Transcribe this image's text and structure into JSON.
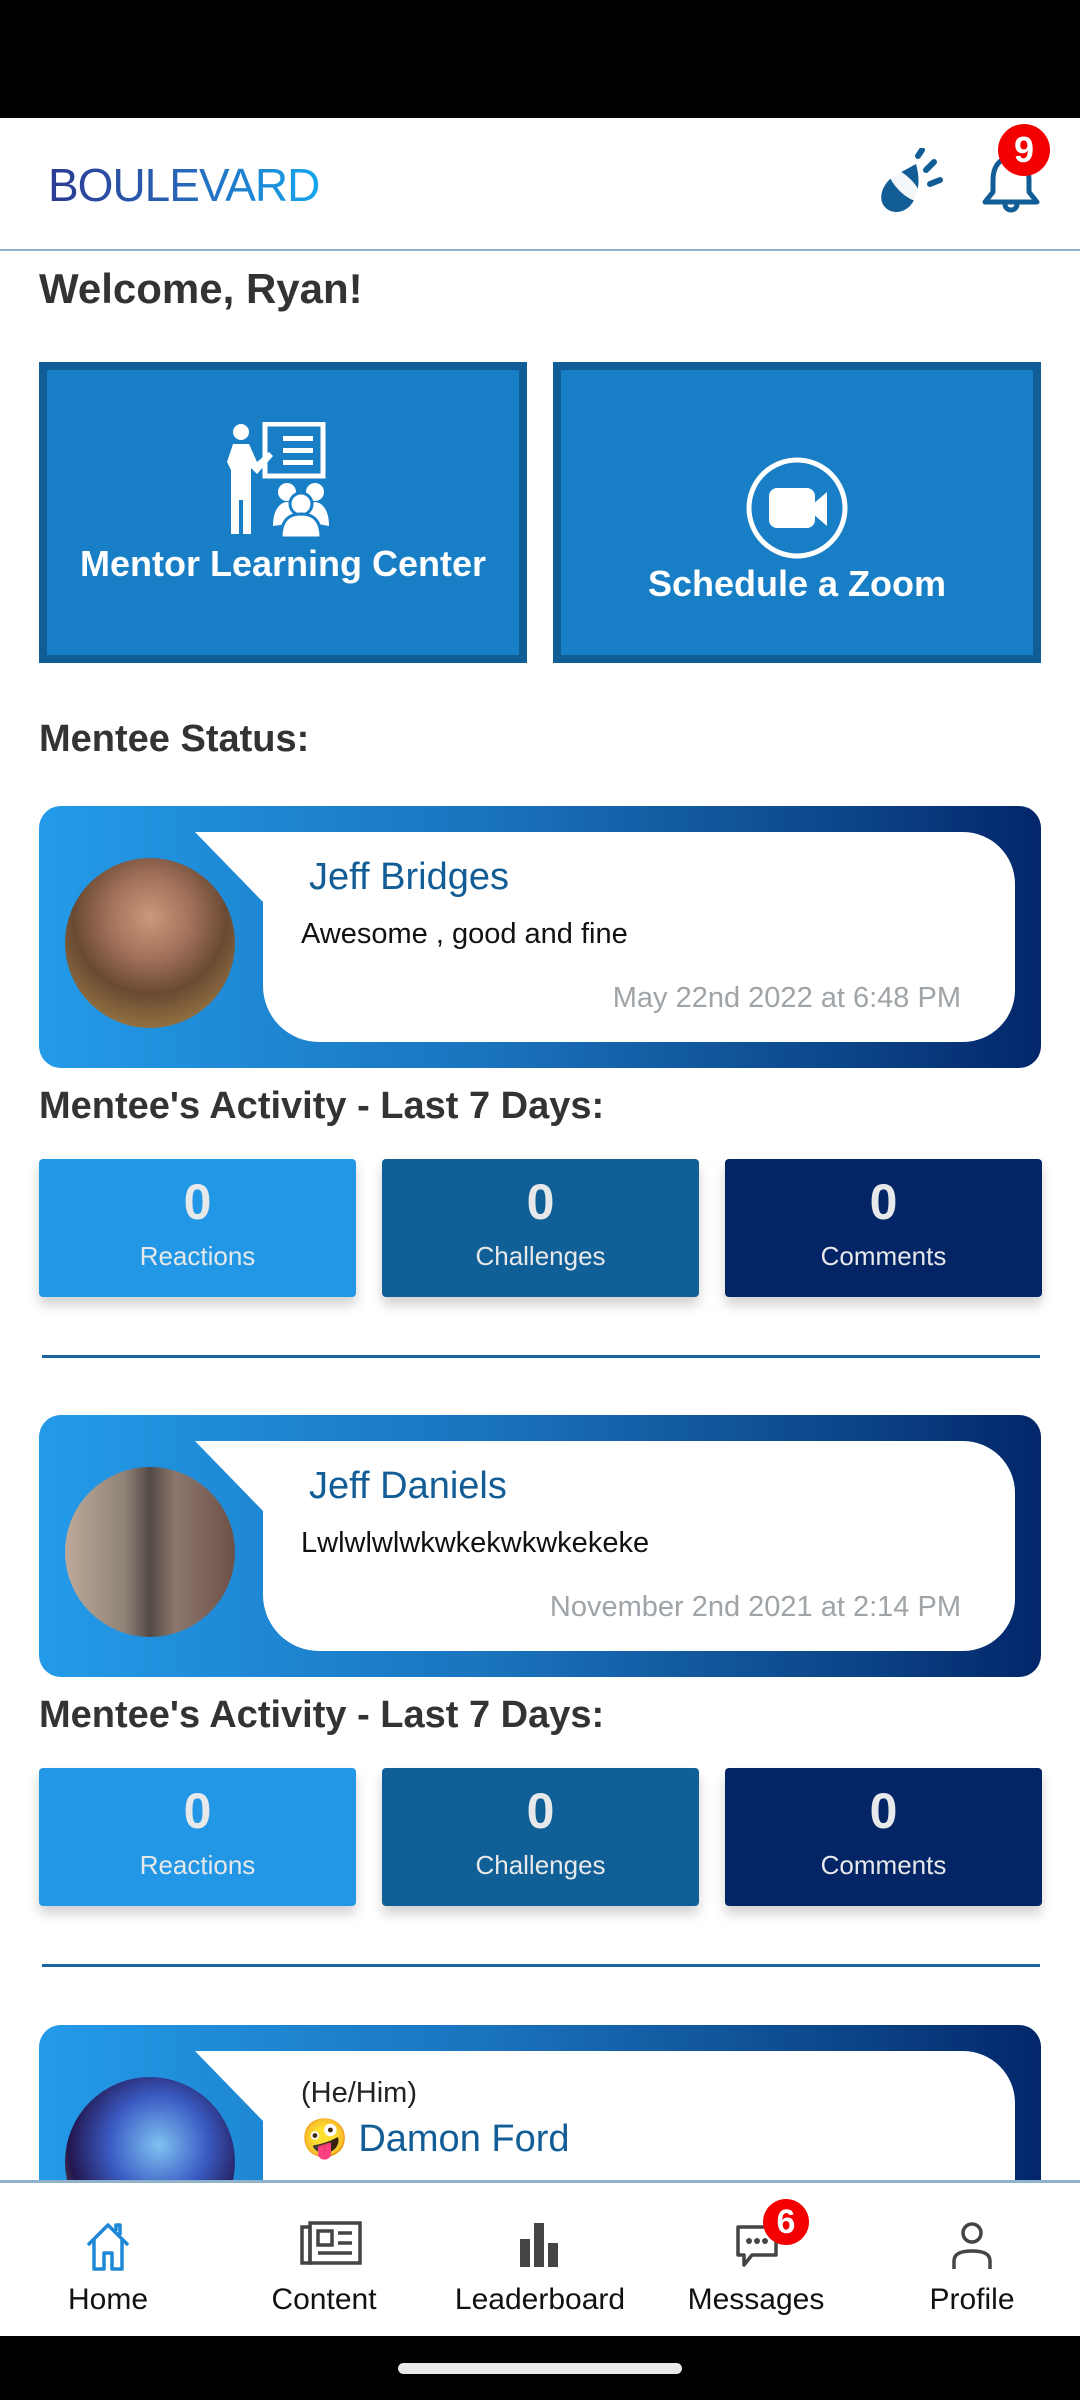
{
  "header": {
    "logo": "BOULEVARD",
    "notification_count": "9",
    "icons": [
      "announcement-icon",
      "bell-icon"
    ]
  },
  "welcome": "Welcome, Ryan!",
  "tiles": [
    {
      "label": "Mentor Learning Center",
      "icon": "mentor-presentation-icon"
    },
    {
      "label": "Schedule a Zoom",
      "icon": "video-camera-icon"
    }
  ],
  "mentee_status_title": "Mentee Status:",
  "activity_title": "Mentee's Activity - Last 7 Days:",
  "mentees": [
    {
      "name": "Jeff Bridges",
      "status": "Awesome , good and fine",
      "date": "May 22nd 2022 at 6:48 PM",
      "activity": {
        "reactions": "0",
        "challenges": "0",
        "comments": "0"
      }
    },
    {
      "name": "Jeff Daniels",
      "status": "Lwlwlwlwkwkekwkwkekeke",
      "date": "November 2nd 2021 at 2:14 PM",
      "activity": {
        "reactions": "0",
        "challenges": "0",
        "comments": "0"
      }
    },
    {
      "pronouns": "(He/Him)",
      "emoji": "🤪",
      "name": "Damon Ford"
    }
  ],
  "stat_labels": {
    "reactions": "Reactions",
    "challenges": "Challenges",
    "comments": "Comments"
  },
  "bottom_nav": {
    "items": [
      {
        "label": "Home",
        "active": true
      },
      {
        "label": "Content"
      },
      {
        "label": "Leaderboard"
      },
      {
        "label": "Messages",
        "badge": "6"
      },
      {
        "label": "Profile"
      }
    ]
  },
  "colors": {
    "brand_blue": "#135d96",
    "active_nav": "#1e88d6",
    "badge_red": "#f40000",
    "reactions_bg": "#2197e6",
    "challenges_bg": "#115f97",
    "comments_bg": "#032566"
  }
}
